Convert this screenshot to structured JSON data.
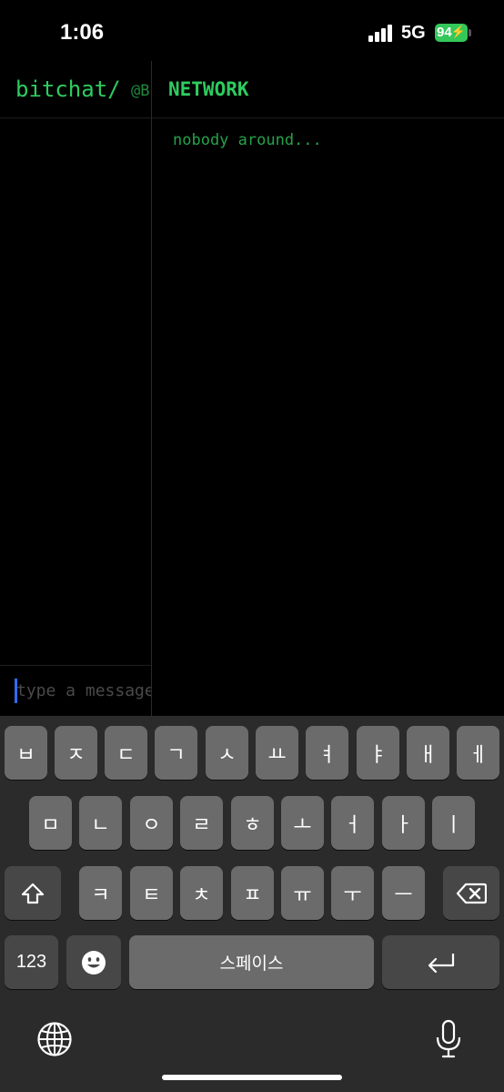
{
  "status_bar": {
    "time": "1:06",
    "network": "5G",
    "battery": "94"
  },
  "header": {
    "app_title": "bitchat/",
    "nickname": "@B",
    "network_title": "NETWORK"
  },
  "people": {
    "empty_message": "nobody around..."
  },
  "composer": {
    "placeholder": "type a message..."
  },
  "keyboard": {
    "row1": [
      "ㅂ",
      "ㅈ",
      "ㄷ",
      "ㄱ",
      "ㅅ",
      "ㅛ",
      "ㅕ",
      "ㅑ",
      "ㅐ",
      "ㅔ"
    ],
    "row2": [
      "ㅁ",
      "ㄴ",
      "ㅇ",
      "ㄹ",
      "ㅎ",
      "ㅗ",
      "ㅓ",
      "ㅏ",
      "ㅣ"
    ],
    "row3": [
      "ㅋ",
      "ㅌ",
      "ㅊ",
      "ㅍ",
      "ㅠ",
      "ㅜ",
      "ㅡ"
    ],
    "numbers_label": "123",
    "space_label": "스페이스",
    "icons": {
      "shift": "shift-icon",
      "delete": "delete-icon",
      "emoji": "emoji-icon",
      "return": "return-icon",
      "globe": "globe-icon",
      "microphone": "microphone-icon"
    }
  },
  "colors": {
    "accent_green": "#2ecc5f",
    "dim_green": "#25a24b",
    "battery_green": "#34c759",
    "cursor_blue": "#2f6bff"
  }
}
